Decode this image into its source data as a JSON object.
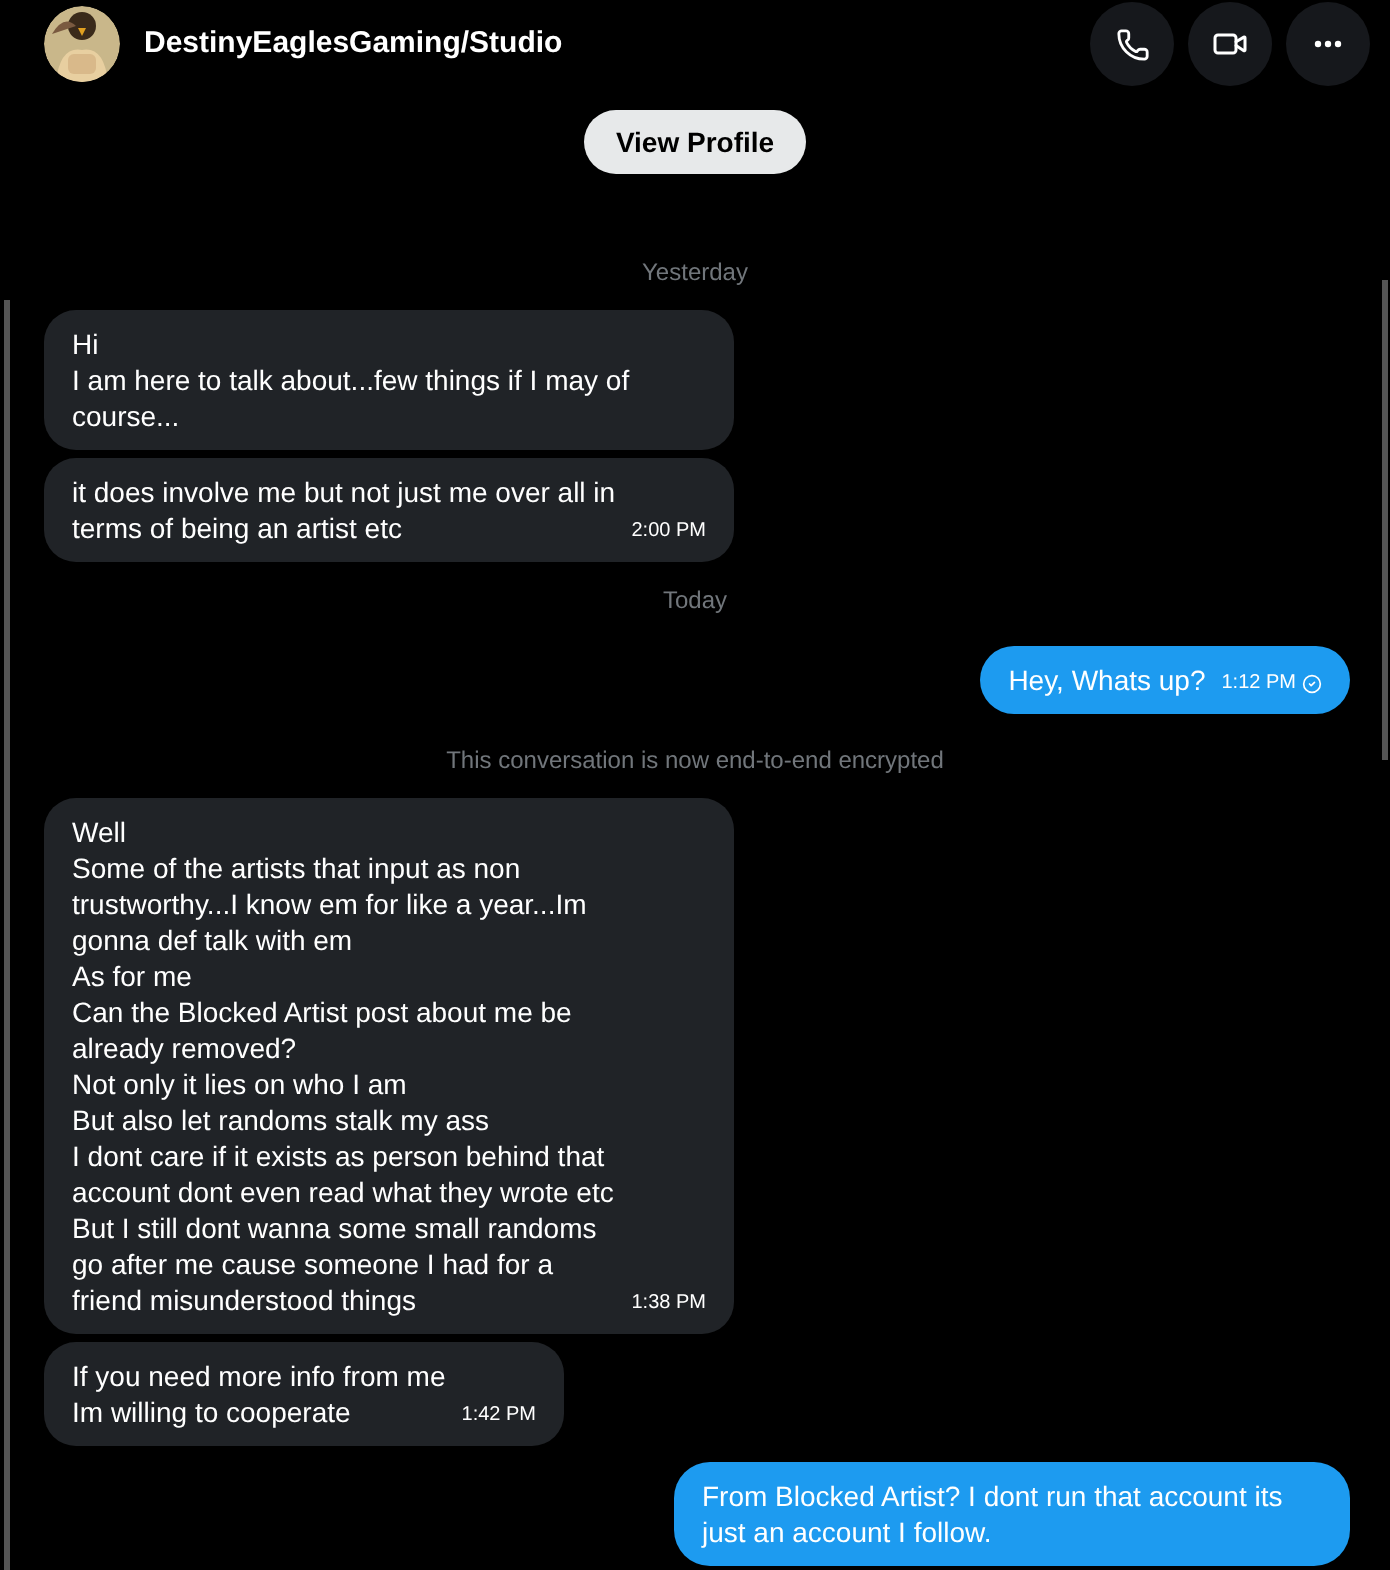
{
  "header": {
    "name": "DestinyEaglesGaming/Studio",
    "view_profile": "View Profile"
  },
  "items": [
    {
      "kind": "date",
      "text": "Yesterday"
    },
    {
      "kind": "received",
      "text": "Hi\nI am here to talk about...few things if I may of course..."
    },
    {
      "kind": "received",
      "text": "it does involve me but not just me over all in terms of being an artist etc",
      "time": "2:00 PM"
    },
    {
      "kind": "date",
      "text": "Today"
    },
    {
      "kind": "sent",
      "text": "Hey, Whats up?",
      "time": "1:12 PM",
      "read": true
    },
    {
      "kind": "notice",
      "text": "This conversation is now end-to-end encrypted"
    },
    {
      "kind": "received",
      "text": "Well\nSome of the artists that input as non trustworthy...I know em for like a year...Im gonna def talk with em\nAs for me\nCan the Blocked Artist post about me be already removed?\nNot only it lies on who I am\nBut also let randoms stalk my ass\nI dont care if it exists as person behind that account dont even read what they wrote etc\nBut I still dont wanna some small randoms go after me cause someone I had for a friend misunderstood things",
      "time": "1:38 PM"
    },
    {
      "kind": "received",
      "text": "If you need more info from me\nIm willing to cooperate",
      "time": "1:42 PM"
    },
    {
      "kind": "sent",
      "text": "From Blocked Artist? I dont run that account its just an account I follow."
    }
  ]
}
